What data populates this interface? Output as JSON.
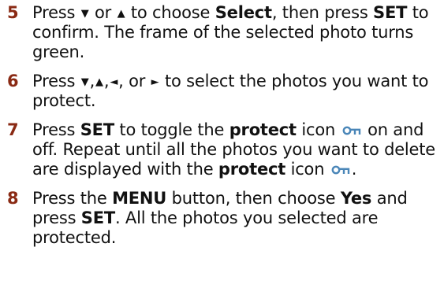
{
  "steps": [
    {
      "number": "5",
      "segments": [
        "Press ",
        "▼",
        " or ",
        "▲",
        " to choose ",
        "Select",
        ", then press ",
        "SET",
        " to confirm. The frame of the selected photo turns green."
      ]
    },
    {
      "number": "6",
      "segments": [
        "Press ",
        "▼",
        ",",
        "▲",
        ",",
        "◄",
        ", or ",
        "►",
        " to select the photos you want to protect."
      ]
    },
    {
      "number": "7",
      "segments": [
        "Press ",
        "SET",
        " to toggle the ",
        "protect",
        " icon ",
        " on and off. Repeat until all the photos you want to delete are displayed with the ",
        "protect",
        " icon ",
        "."
      ]
    },
    {
      "number": "8",
      "segments": [
        "Press the ",
        "MENU",
        " button, then choose ",
        "Yes",
        " and press ",
        "SET",
        ". All the photos you selected are protected."
      ]
    }
  ],
  "colors": {
    "step_number": "#8a2a14",
    "body_text": "#111111",
    "protect_icon": "#4a86b8"
  },
  "icons": {
    "protect": "protect-key-icon"
  }
}
